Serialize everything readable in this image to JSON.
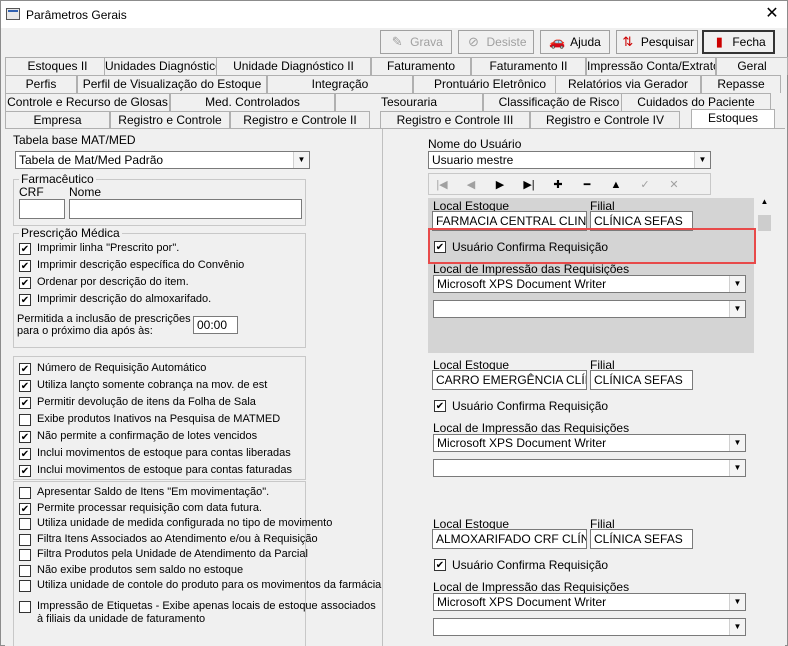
{
  "window": {
    "title": "Parâmetros Gerais",
    "close": "✕"
  },
  "toolbar": {
    "grava": "Grava",
    "desiste": "Desiste",
    "ajuda": "Ajuda",
    "pesquisar": "Pesquisar",
    "fecha": "Fecha"
  },
  "tabs": {
    "row1": [
      "Estoques II",
      "Unidades Diagnóstico",
      "Unidade Diagnóstico II",
      "Faturamento",
      "Faturamento II",
      "Impressão Conta/Extrato",
      "Geral"
    ],
    "row2": [
      "Perfis",
      "Perfil de Visualização do Estoque",
      "Integração",
      "Prontuário Eletrônico",
      "Relatórios via Gerador",
      "Repasse"
    ],
    "row3": [
      "Controle e Recurso de Glosas",
      "Med. Controlados",
      "Tesouraria",
      "Classificação de Risco",
      "Cuidados do Paciente"
    ],
    "row4": [
      "Empresa",
      "Registro e Controle",
      "Registro e Controle II",
      "Registro e Controle III",
      "Registro e Controle IV",
      "Estoques"
    ]
  },
  "left": {
    "tabela_label": "Tabela base MAT/MED",
    "tabela_value": "Tabela de Mat/Med Padrão",
    "farm_group": "Farmacêutico",
    "crf_label": "CRF",
    "nome_label": "Nome",
    "crf_value": "",
    "nome_value": "",
    "presc_group": "Prescrição Médica",
    "presc_items": [
      "Imprimir linha \"Prescrito por\".",
      "Imprimir descrição específica do Convênio",
      "Ordenar por descrição do item.",
      "Imprimir descrição do almoxarifado."
    ],
    "permitida_line1": "Permitida a inclusão de prescrições",
    "permitida_line2": "para o próximo dia após às:",
    "permitida_time": "00:00",
    "group2": [
      "Número de Requisição Automático",
      "Utiliza lançto somente cobrança na mov. de est",
      "Permitir devolução de itens da Folha de Sala",
      "Exibe produtos Inativos na Pesquisa de MATMED",
      "Não permite a confirmação de lotes vencidos",
      "Inclui movimentos de estoque para contas liberadas",
      "Inclui movimentos de estoque para contas faturadas"
    ],
    "group3": [
      "Apresentar Saldo de Itens \"Em movimentação\".",
      "Permite processar requisição com data futura.",
      "Utiliza unidade de medida configurada no tipo de movimento",
      "Filtra Itens Associados ao Atendimento e/ou à Requisição",
      "Filtra Produtos pela Unidade de Atendimento da Parcial",
      "Não exibe produtos sem saldo no estoque",
      "Utiliza unidade de contole do produto para os movimentos da farmácia"
    ],
    "group3_last_line1": "Impressão de Etiquetas - Exibe apenas locais de estoque associados",
    "group3_last_line2": "à filiais da unidade de faturamento"
  },
  "right": {
    "usuario_label": "Nome do Usuário",
    "usuario_value": "Usuario mestre",
    "nav": [
      "|◀",
      "◀",
      "▶",
      "▶|",
      "✚",
      "━",
      "▲",
      "✓",
      "✕"
    ],
    "panels": [
      {
        "local_label": "Local Estoque",
        "local_value": "FARMACIA CENTRAL CLINICA",
        "filial_label": "Filial",
        "filial_value": "CLÍNICA SEFAS",
        "confirma": "Usuário Confirma Requisição",
        "impressao_label": "Local de Impressão das Requisições",
        "printer": "Microsoft XPS Document Writer",
        "printer2": ""
      },
      {
        "local_label": "Local Estoque",
        "local_value": "CARRO EMERGÊNCIA CLÍNICA",
        "filial_label": "Filial",
        "filial_value": "CLÍNICA SEFAS",
        "confirma": "Usuário Confirma Requisição",
        "impressao_label": "Local de Impressão das Requisições",
        "printer": "Microsoft XPS Document Writer",
        "printer2": ""
      },
      {
        "local_label": "Local Estoque",
        "local_value": "ALMOXARIFADO CRF CLÍNICA",
        "filial_label": "Filial",
        "filial_value": "CLÍNICA SEFAS",
        "confirma": "Usuário Confirma Requisição",
        "impressao_label": "Local de Impressão das Requisições",
        "printer": "Microsoft XPS Document Writer",
        "printer2": ""
      }
    ]
  },
  "colors": {
    "highlight": "#e84a4a",
    "panel_bg": "#d4d4d4"
  }
}
